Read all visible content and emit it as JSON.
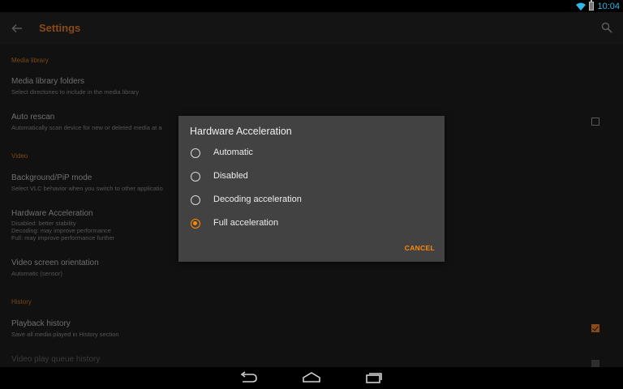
{
  "status": {
    "time": "10:04",
    "icons": [
      "wifi-icon",
      "battery-icon"
    ]
  },
  "app_bar": {
    "title": "Settings",
    "back_icon": "arrow-left-icon",
    "search_icon": "search-icon"
  },
  "sections": {
    "media_library": {
      "header": "Media library",
      "folders_title": "Media library folders",
      "folders_summary": "Select directories to include in the media library",
      "rescan_title": "Auto rescan",
      "rescan_summary": "Automatically scan device for new or deleted media at a",
      "rescan_checked": false
    },
    "video": {
      "header": "Video",
      "bg_title": "Background/PiP mode",
      "bg_summary": "Select VLC behavior when you switch to other applicatio",
      "hw_title": "Hardware Acceleration",
      "hw_summary": "Disabled: better stability\nDecoding: may improve performance\nFull: may improve performance further",
      "orientation_title": "Video screen orientation",
      "orientation_summary": "Automatic (sensor)"
    },
    "history": {
      "header": "History",
      "playback_title": "Playback history",
      "playback_summary": "Save all media played in History section",
      "playback_checked": true,
      "queue_title": "Video play queue history",
      "queue_checked": true
    }
  },
  "dialog": {
    "title": "Hardware Acceleration",
    "options": [
      "Automatic",
      "Disabled",
      "Decoding acceleration",
      "Full acceleration"
    ],
    "selected": "Full acceleration",
    "cancel": "CANCEL"
  },
  "nav": {
    "icons": [
      "back-nav-icon",
      "home-nav-icon",
      "recents-nav-icon"
    ]
  },
  "colors": {
    "accent": "#ff8800",
    "accent_dim": "#8a4a16",
    "dialog_bg": "#424242",
    "background": "#111111"
  }
}
